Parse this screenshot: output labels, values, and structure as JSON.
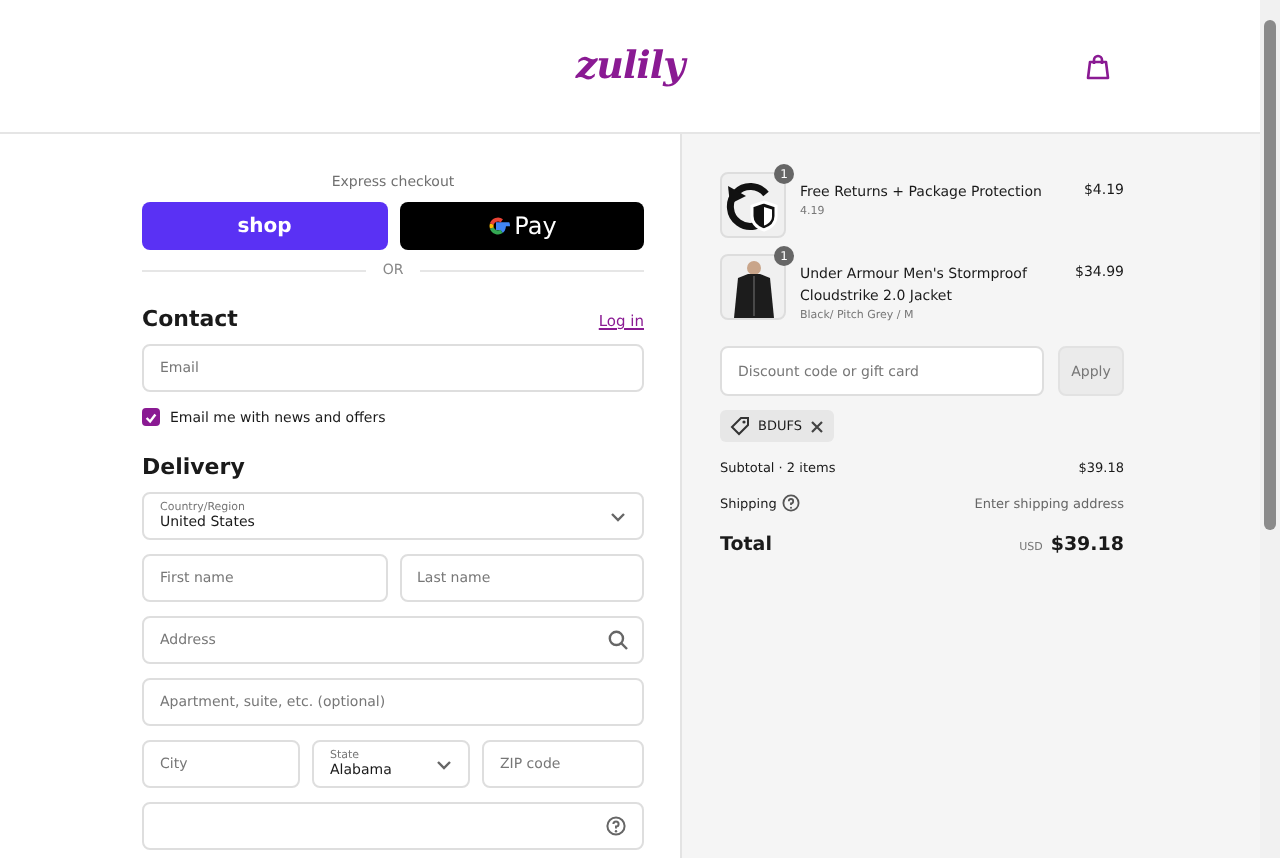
{
  "header": {
    "logo": "zulily"
  },
  "express": {
    "title": "Express checkout",
    "shop_button": "shop",
    "gpay_button": "Pay",
    "divider": "OR"
  },
  "contact": {
    "title": "Contact",
    "login_link": "Log in",
    "email": {
      "placeholder": "Email"
    },
    "newsletter": {
      "label": "Email me with news and offers",
      "checked": true
    }
  },
  "delivery": {
    "title": "Delivery",
    "country": {
      "label": "Country/Region",
      "value": "United States"
    },
    "first_name": {
      "placeholder": "First name"
    },
    "last_name": {
      "placeholder": "Last name"
    },
    "address": {
      "placeholder": "Address"
    },
    "apartment": {
      "placeholder": "Apartment, suite, etc. (optional)"
    },
    "city": {
      "placeholder": "City"
    },
    "state": {
      "label": "State",
      "value": "Alabama"
    },
    "zip": {
      "placeholder": "ZIP code"
    }
  },
  "summary": {
    "items": [
      {
        "kind": "service",
        "quantity": "1",
        "name": "Free Returns + Package Protection",
        "variant": "4.19",
        "price": "$4.19"
      },
      {
        "kind": "product",
        "quantity": "1",
        "name": "Under Armour Men's Stormproof Cloudstrike 2.0 Jacket",
        "variant": "Black/ Pitch Grey / M",
        "price": "$34.99"
      }
    ],
    "discount": {
      "placeholder": "Discount code or gift card",
      "button": "Apply"
    },
    "applied_code": "BDUFS",
    "subtotal": {
      "label": "Subtotal · 2 items",
      "value": "$39.18"
    },
    "shipping": {
      "label": "Shipping",
      "value": "Enter shipping address"
    },
    "total": {
      "label": "Total",
      "currency": "USD",
      "value": "$39.18"
    }
  }
}
